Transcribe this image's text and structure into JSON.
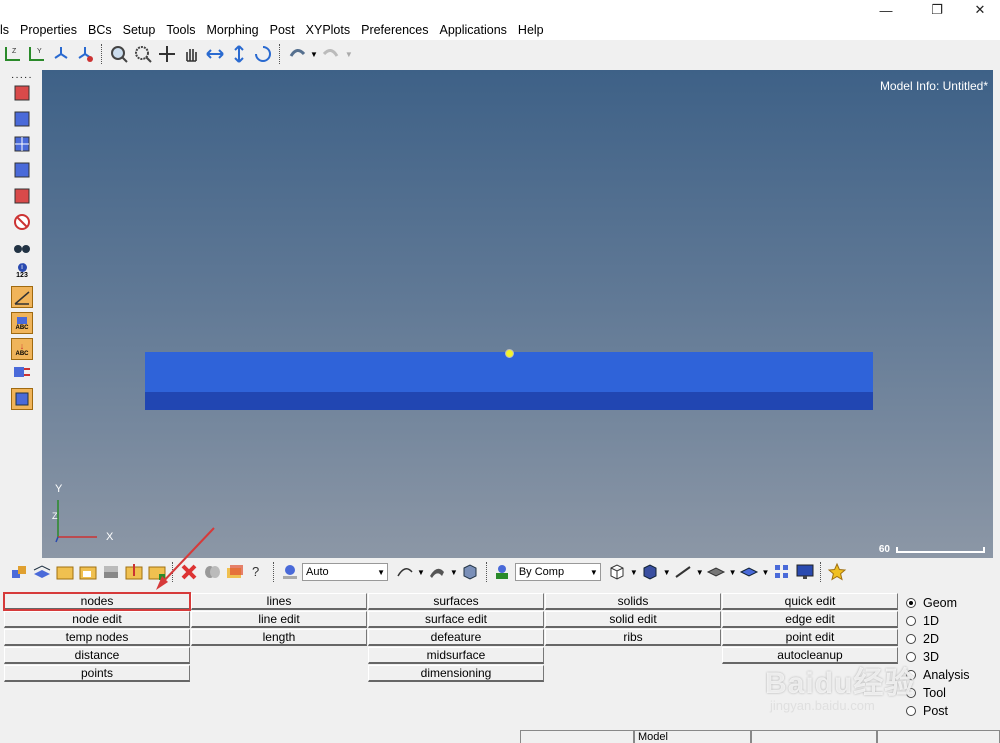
{
  "window": {
    "minimize_glyph": "—",
    "maximize_glyph": "❐",
    "close_glyph": "✕"
  },
  "menu": [
    "ls",
    "Properties",
    "BCs",
    "Setup",
    "Tools",
    "Morphing",
    "Post",
    "XYPlots",
    "Preferences",
    "Applications",
    "Help"
  ],
  "viewport": {
    "model_info": "Model Info: Untitled*",
    "scale_value": "60",
    "axis": {
      "y": "Y",
      "z": "Z",
      "x": "X"
    }
  },
  "left_toolbar": {
    "info_label": "123",
    "abc_label": "ABC"
  },
  "bottom_toolbar": {
    "display_mode": "Auto",
    "color_mode": "By Comp"
  },
  "panel": {
    "columns": [
      [
        "nodes",
        "node edit",
        "temp nodes",
        "distance",
        "points"
      ],
      [
        "lines",
        "line edit",
        "length"
      ],
      [
        "surfaces",
        "surface edit",
        "defeature",
        "midsurface",
        "dimensioning"
      ],
      [
        "solids",
        "solid edit",
        "ribs"
      ],
      [
        "quick edit",
        "edge edit",
        "point edit",
        "autocleanup"
      ]
    ],
    "highlighted": "nodes",
    "pages": [
      {
        "label": "Geom",
        "selected": true
      },
      {
        "label": "1D",
        "selected": false
      },
      {
        "label": "2D",
        "selected": false
      },
      {
        "label": "3D",
        "selected": false
      },
      {
        "label": "Analysis",
        "selected": false
      },
      {
        "label": "Tool",
        "selected": false
      },
      {
        "label": "Post",
        "selected": false
      }
    ]
  },
  "status": {
    "mode": "Model"
  },
  "watermark": {
    "main": "Baidu经验",
    "sub": "jingyan.baidu.com"
  },
  "colors": {
    "beam": "#2f63d9",
    "beam_edge": "#2146b2",
    "node": "#f1f22c",
    "highlight": "#d63a3a"
  }
}
